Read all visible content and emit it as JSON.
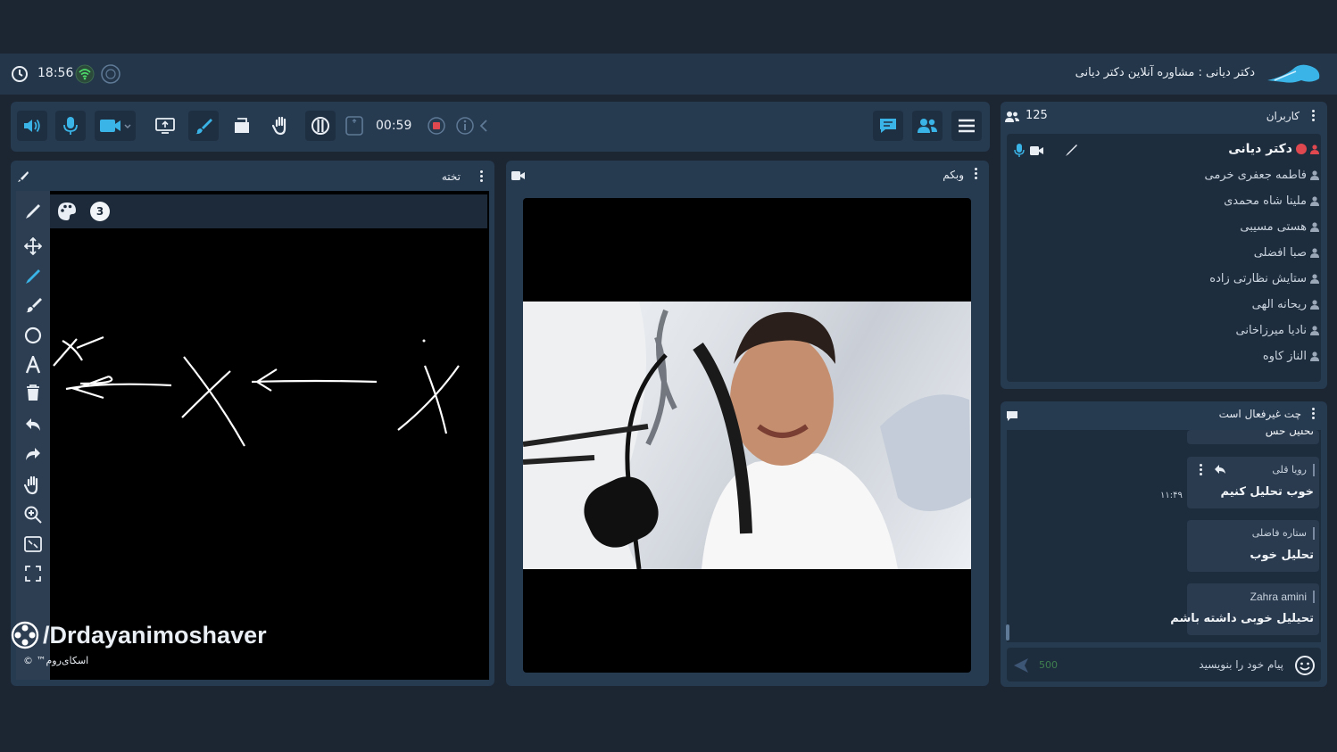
{
  "topbar": {
    "time": "18:56",
    "title": "دکتر دیانی : مشاوره آنلاین دکتر دیانی"
  },
  "toolbar": {
    "timer": "00:59"
  },
  "whiteboard": {
    "title": "تخته",
    "page_number": "3"
  },
  "webcam": {
    "title": "وبکم"
  },
  "users": {
    "title": "کاربران",
    "count": "125",
    "list": [
      "دکتر دیانی",
      "فاطمه جعفری خرمی",
      "ملینا شاه محمدی",
      "هستی مسیبی",
      "صبا افضلی",
      "ستایش نظارتی زاده",
      "ریحانه الهی",
      "نادیا میرزاخانی",
      "الناز کاوه"
    ]
  },
  "chat": {
    "title": "چت غیرفعال است",
    "partial_msg": "تحلیل خش",
    "messages": [
      {
        "sender": "رویا قلی",
        "text": "خوب تحلیل کنیم",
        "time": "۱۱:۴۹"
      },
      {
        "sender": "ستاره فاضلی",
        "text": "تحلیل خوب",
        "time": ""
      },
      {
        "sender": "Zahra amini",
        "text": "تحیلیل خوبی داشته باشم",
        "time": ""
      }
    ],
    "input_placeholder": "پیام خود را بنویسید",
    "char_limit": "500"
  },
  "watermark": {
    "handle": "/Drdayanimoshaver",
    "brand": "اسکای‌روم™ ©"
  },
  "colors": {
    "accent": "#3ab4e6",
    "record": "#e0484f",
    "bg": "#1c2633",
    "panel": "#263a50"
  }
}
